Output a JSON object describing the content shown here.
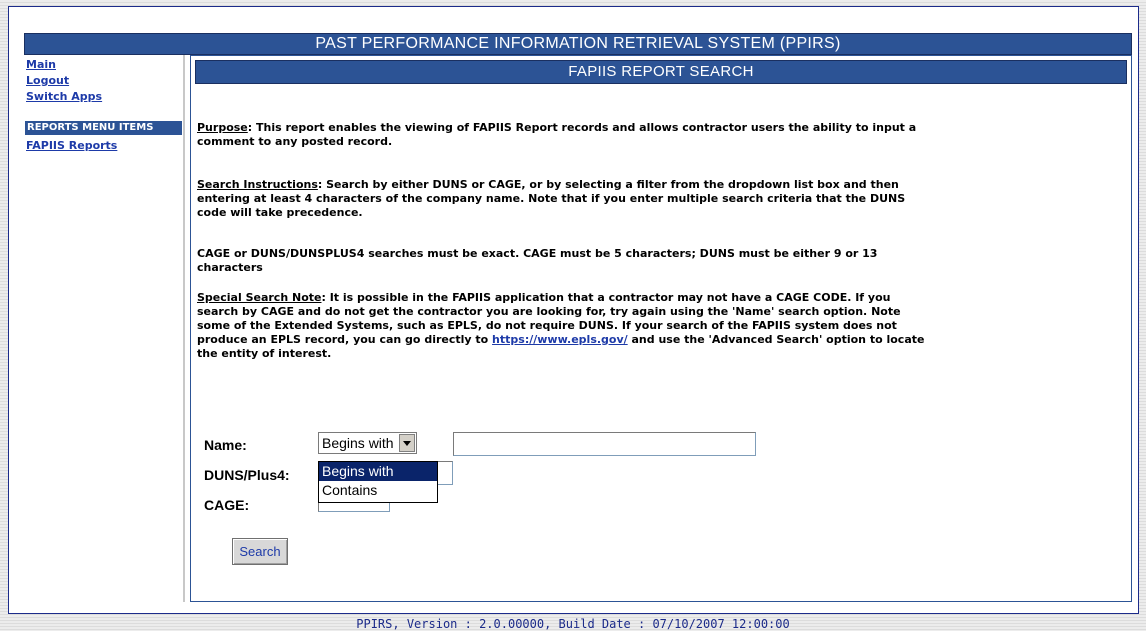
{
  "app": {
    "title": "PAST PERFORMANCE INFORMATION RETRIEVAL SYSTEM (PPIRS)"
  },
  "sidebar": {
    "links": [
      "Main",
      "Logout",
      "Switch Apps"
    ],
    "section_title": "REPORTS MENU ITEMS",
    "menu_items": [
      "FAPIIS Reports"
    ]
  },
  "report": {
    "title": "FAPIIS REPORT SEARCH",
    "purpose": {
      "lead": "Purpose",
      "text": ": This report enables the viewing of FAPIIS Report records and allows contractor users the ability to input a comment to any posted record."
    },
    "instructions": {
      "lead": "Search Instructions",
      "text": ": Search by either DUNS or CAGE, or by selecting a filter from the dropdown list box and then entering at least 4 characters of the company name. Note that if you enter multiple search criteria that the DUNS code will take precedence."
    },
    "exact_note": "CAGE or DUNS/DUNSPLUS4 searches must be exact. CAGE must be 5 characters; DUNS must be either 9 or 13 characters",
    "special_note": {
      "lead": "Special Search Note",
      "text_before_link": ": It is possible in the FAPIIS application that a contractor may not have a CAGE CODE. If you search by CAGE and do not get the contractor you are looking for, try again using the 'Name' search option. Note some of the Extended Systems, such as EPLS, do not require DUNS. If your search of the FAPIIS system does not produce an EPLS record, you can go directly to ",
      "link": "https://www.epls.gov/",
      "text_after_link": " and use the 'Advanced Search' option to locate the entity of interest."
    }
  },
  "form": {
    "name_label": "Name:",
    "duns_label": "DUNS/Plus4:",
    "cage_label": "CAGE:",
    "filter_selected": "Begins with",
    "filter_options": [
      "Begins with",
      "Contains"
    ],
    "name_value": "",
    "duns_value": "",
    "cage_value": "",
    "search_label": "Search"
  },
  "footer": {
    "text": "PPIRS, Version : 2.0.00000, Build Date : 07/10/2007 12:00:00"
  },
  "colors": {
    "header_bg": "#2c5395",
    "link": "#1d3aa8",
    "selected_option": "#0a246a"
  }
}
